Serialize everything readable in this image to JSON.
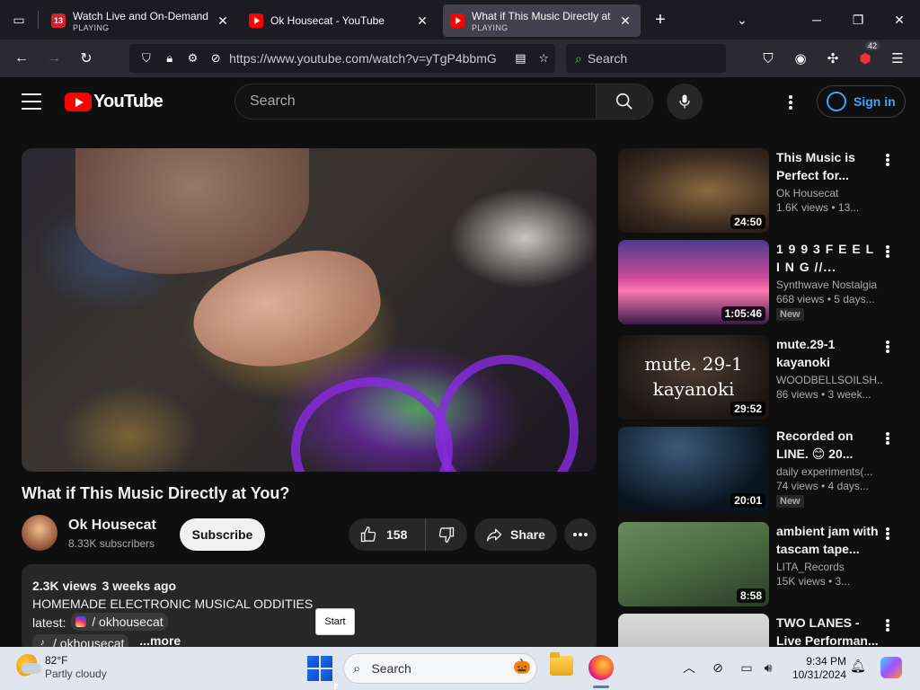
{
  "browser": {
    "tabs": [
      {
        "title": "Watch Live and On-Demand Vi",
        "status": "PLAYING",
        "favicon": "13-icon",
        "active": false
      },
      {
        "title": "Ok Housecat - YouTube",
        "status": "",
        "favicon": "youtube-icon",
        "active": false
      },
      {
        "title": "What if This Music Directly at Y",
        "status": "PLAYING",
        "favicon": "youtube-icon",
        "active": true
      }
    ],
    "favicon_13_text": "13",
    "url": "https://www.youtube.com/watch?v=yTgP4bbmG",
    "search_placeholder": "Search",
    "extension_badge": "42"
  },
  "youtube": {
    "logo_text": "YouTube",
    "search_placeholder": "Search",
    "sign_in_label": "Sign in",
    "video": {
      "title": "What if This Music Directly at You?",
      "channel_name": "Ok Housecat",
      "subscribers": "8.33K subscribers",
      "subscribe_label": "Subscribe",
      "likes": "158",
      "share_label": "Share",
      "description": {
        "views": "2.3K views",
        "age": "3 weeks ago",
        "line1": "HOMEMADE ELECTRONIC MUSICAL ODDITIES",
        "latest_label": "latest:",
        "instagram_handle": "/ okhousecat",
        "tiktok_handle": "/ okhousecat",
        "more_label": "...more"
      }
    },
    "recommendations": [
      {
        "title": "This Music is Perfect for...",
        "channel": "Ok Housecat",
        "meta": "1.6K views  •  13...",
        "duration": "24:50",
        "new": false
      },
      {
        "title": "1 9 9 3   F E E L I N G //...",
        "channel": "Synthwave Nostalgia",
        "meta": "668 views  •  5 days...",
        "duration": "1:05:46",
        "new": true
      },
      {
        "title": "mute.29-1 kayanoki",
        "channel": "WOODBELLSOILSH...",
        "meta": "86 views  •  3 week...",
        "duration": "29:52",
        "new": false,
        "thumb_text_1": "mute. 29-1",
        "thumb_text_2": "kayanoki"
      },
      {
        "title": "Recorded on LINE. 😊 20...",
        "channel": "daily experiments(...",
        "meta": "74 views  •  4 days...",
        "duration": "20:01",
        "new": true
      },
      {
        "title": "ambient jam with tascam tape...",
        "channel": "LITA_Records",
        "meta": "15K views  •  3...",
        "duration": "8:58",
        "new": false
      },
      {
        "title": "TWO LANES - Live Performan...",
        "channel": "",
        "meta": "",
        "duration": "",
        "new": false
      }
    ],
    "new_label": "New"
  },
  "tooltip": "Start",
  "taskbar": {
    "temperature": "82°F",
    "condition": "Partly cloudy",
    "search_placeholder": "Search",
    "time": "9:34 PM",
    "date": "10/31/2024"
  },
  "colors": {
    "youtube_red": "#ff0000",
    "link_blue": "#3ea6ff",
    "firefox_tabstrip": "#1c1b22"
  }
}
